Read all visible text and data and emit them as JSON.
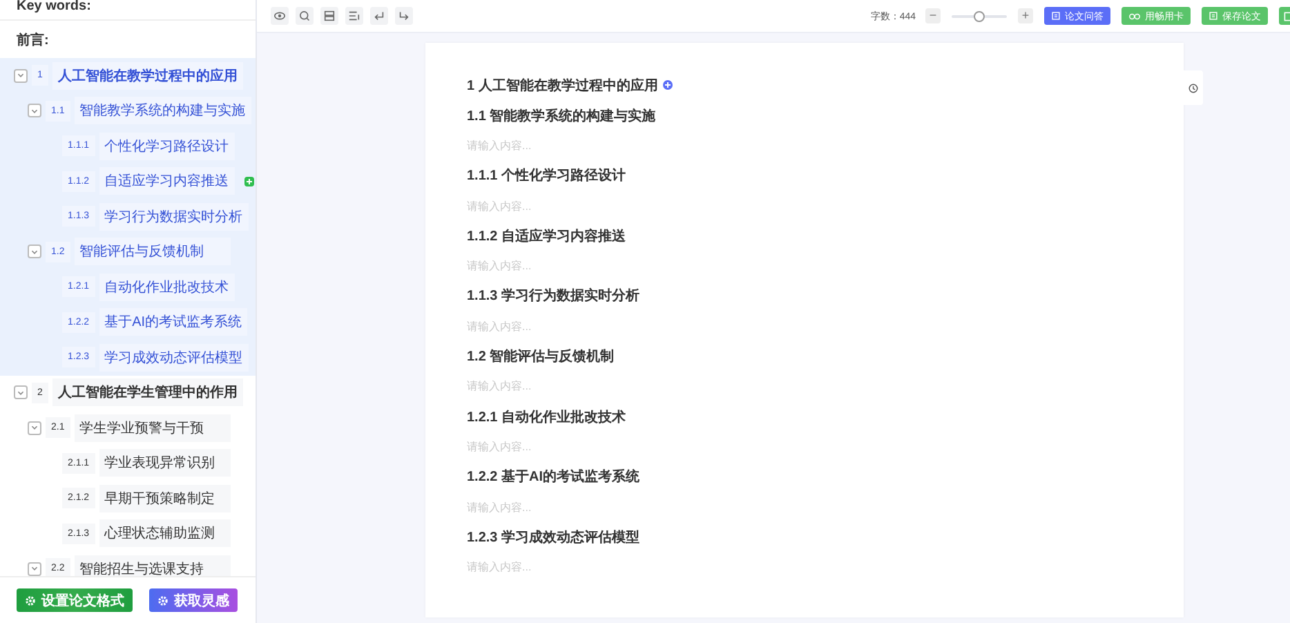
{
  "sidebar": {
    "keywords_label": "Key words:",
    "preface_label": "前言:",
    "outline": [
      {
        "number": "1",
        "title": "人工智能在教学过程中的应用",
        "selected": true,
        "expanded": true,
        "hovered": false,
        "children": [
          {
            "number": "1.1",
            "title": "智能教学系统的构建与实施",
            "expanded": true,
            "hovered": false,
            "children": [
              {
                "number": "1.1.1",
                "title": "个性化学习路径设计",
                "hovered": false
              },
              {
                "number": "1.1.2",
                "title": "自适应学习内容推送",
                "hovered": true
              },
              {
                "number": "1.1.3",
                "title": "学习行为数据实时分析",
                "hovered": false
              }
            ]
          },
          {
            "number": "1.2",
            "title": "智能评估与反馈机制",
            "expanded": true,
            "hovered": false,
            "children": [
              {
                "number": "1.2.1",
                "title": "自动化作业批改技术",
                "hovered": false
              },
              {
                "number": "1.2.2",
                "title": "基于AI的考试监考系统",
                "hovered": false
              },
              {
                "number": "1.2.3",
                "title": "学习成效动态评估模型",
                "hovered": false
              }
            ]
          }
        ]
      },
      {
        "number": "2",
        "title": "人工智能在学生管理中的作用",
        "selected": false,
        "expanded": true,
        "hovered": false,
        "children": [
          {
            "number": "2.1",
            "title": "学生学业预警与干预",
            "expanded": true,
            "hovered": false,
            "children": [
              {
                "number": "2.1.1",
                "title": "学业表现异常识别",
                "hovered": false
              },
              {
                "number": "2.1.2",
                "title": "早期干预策略制定",
                "hovered": false
              },
              {
                "number": "2.1.3",
                "title": "心理状态辅助监测",
                "hovered": false
              }
            ]
          },
          {
            "number": "2.2",
            "title": "智能招生与选课支持",
            "expanded": true,
            "hovered": false
          }
        ]
      }
    ],
    "buttons": [
      {
        "label": "设置论文格式",
        "kind": "format"
      },
      {
        "label": "获取灵感",
        "kind": "inspire"
      }
    ]
  },
  "toolbar": {
    "tools": [
      {
        "kind": "preview"
      },
      {
        "kind": "search"
      },
      {
        "kind": "layers"
      },
      {
        "kind": "indent"
      },
      {
        "kind": "undo"
      },
      {
        "kind": "redo"
      }
    ],
    "word_count": "字数：444",
    "zoom": {
      "minus": "−",
      "plus": "+",
      "level": 0.5
    },
    "actions": [
      {
        "label": "论文问答",
        "kind": "qa"
      },
      {
        "label": "用畅用卡",
        "kind": "card"
      },
      {
        "label": "保存论文",
        "kind": "save"
      },
      {
        "kind": "more"
      }
    ]
  },
  "document": {
    "blocks": [
      {
        "kind": "heading",
        "text": "1 人工智能在教学过程中的应用",
        "add_badge": true
      },
      {
        "kind": "heading",
        "text": "1.1 智能教学系统的构建与实施",
        "add_badge": false
      },
      {
        "kind": "placeholder",
        "text": "请输入内容..."
      },
      {
        "kind": "heading",
        "text": "1.1.1 个性化学习路径设计",
        "add_badge": false
      },
      {
        "kind": "placeholder",
        "text": "请输入内容..."
      },
      {
        "kind": "heading",
        "text": "1.1.2 自适应学习内容推送",
        "add_badge": false
      },
      {
        "kind": "placeholder",
        "text": "请输入内容..."
      },
      {
        "kind": "heading",
        "text": "1.1.3 学习行为数据实时分析",
        "add_badge": false
      },
      {
        "kind": "placeholder",
        "text": "请输入内容..."
      },
      {
        "kind": "heading",
        "text": "1.2 智能评估与反馈机制",
        "add_badge": false
      },
      {
        "kind": "placeholder",
        "text": "请输入内容..."
      },
      {
        "kind": "heading",
        "text": "1.2.1 自动化作业批改技术",
        "add_badge": false
      },
      {
        "kind": "placeholder",
        "text": "请输入内容..."
      },
      {
        "kind": "heading",
        "text": "1.2.2 基于AI的考试监考系统",
        "add_badge": false
      },
      {
        "kind": "placeholder",
        "text": "请输入内容..."
      },
      {
        "kind": "heading",
        "text": "1.2.3 学习成效动态评估模型",
        "add_badge": false
      },
      {
        "kind": "placeholder",
        "text": "请输入内容..."
      }
    ]
  }
}
